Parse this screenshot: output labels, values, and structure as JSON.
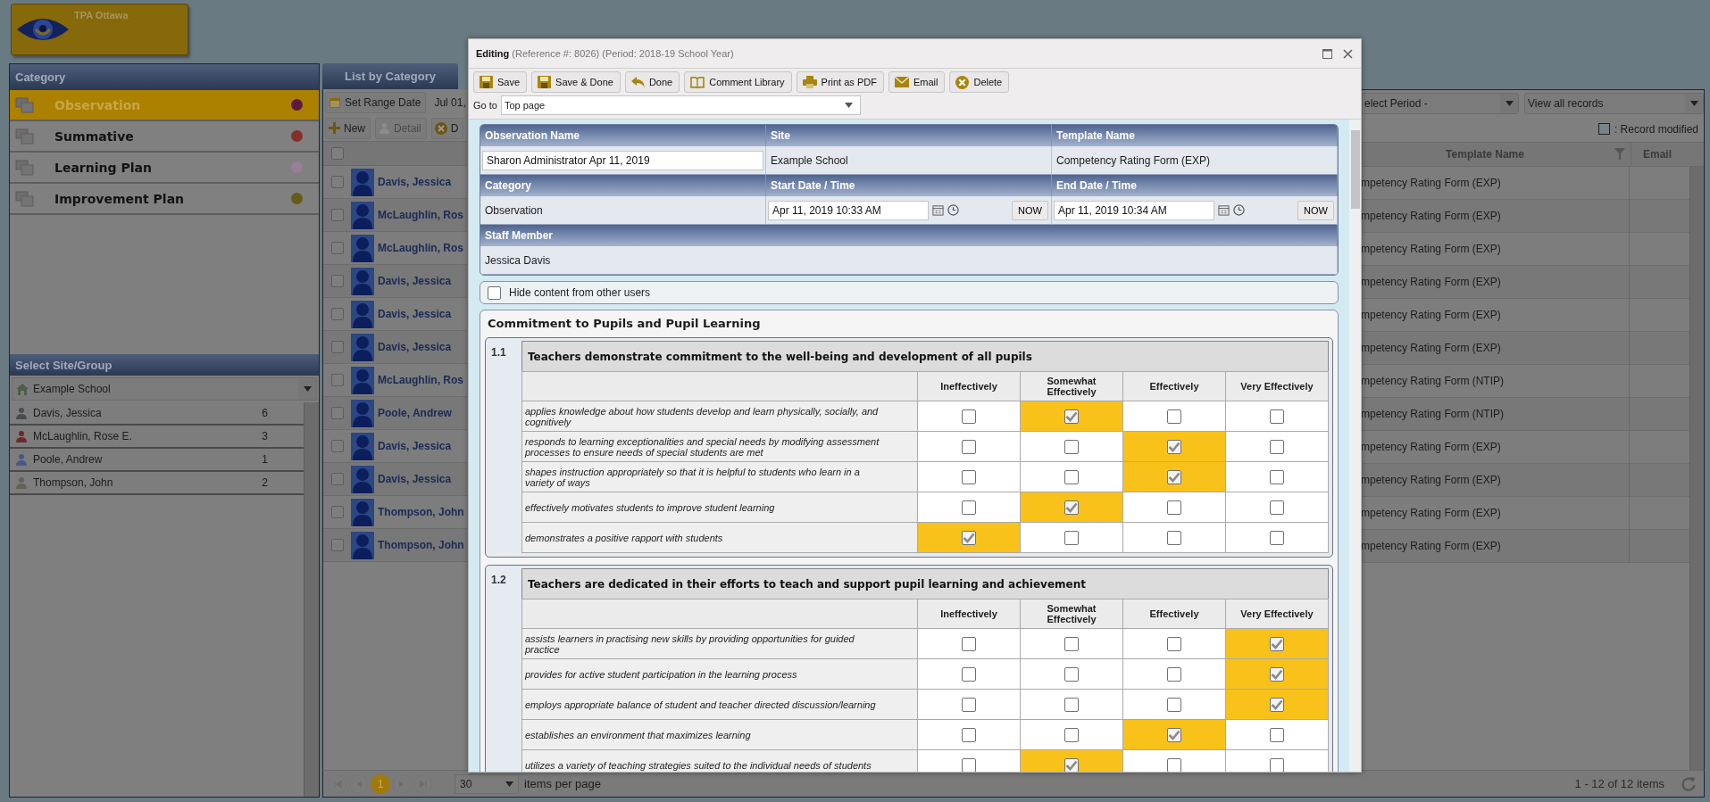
{
  "app_logo": {
    "title": "TPA Ottawa"
  },
  "category_panel": {
    "title": "Category",
    "items": [
      {
        "label": "Observation",
        "selected": true,
        "color": "#5e1a3c"
      },
      {
        "label": "Summative",
        "selected": false,
        "color": "#82302a"
      },
      {
        "label": "Learning Plan",
        "selected": false,
        "color": "#9a7e96"
      },
      {
        "label": "Improvement Plan",
        "selected": false,
        "color": "#675a19"
      }
    ]
  },
  "site_panel": {
    "title": "Select Site/Group",
    "site": "Example School",
    "staff": [
      {
        "name": "Davis, Jessica",
        "count": "6",
        "color": "#474c52"
      },
      {
        "name": "McLaughlin, Rose E.",
        "count": "3",
        "color": "#6a2b2b"
      },
      {
        "name": "Poole, Andrew",
        "count": "1",
        "color": "#45598a"
      },
      {
        "name": "Thompson, John",
        "count": "2",
        "color": "#66605a"
      }
    ]
  },
  "list_panel": {
    "tab": "List by Category",
    "range_button": "Set Range Date",
    "range_text": "Jul 01,",
    "period_select": "elect Period -",
    "view_select": "View all records",
    "buttons": [
      {
        "label": "New",
        "kind": "new",
        "disabled": false
      },
      {
        "label": "Detail",
        "kind": "detail",
        "disabled": true
      },
      {
        "label": "D",
        "kind": "delete",
        "disabled": false
      }
    ],
    "legend": ": Record modified",
    "columns": {
      "template": "Template Name",
      "email": "Email"
    },
    "select_all_checked": false,
    "rows": [
      {
        "name": "Davis, Jessica",
        "template": "mpetency Rating Form (EXP)",
        "checked": false
      },
      {
        "name": "McLaughlin, Ros",
        "template": "mpetency Rating Form (EXP)",
        "checked": false
      },
      {
        "name": "McLaughlin, Ros",
        "template": "mpetency Rating Form (EXP)",
        "checked": false
      },
      {
        "name": "Davis, Jessica",
        "template": "mpetency Rating Form (EXP)",
        "checked": false
      },
      {
        "name": "Davis, Jessica",
        "template": "mpetency Rating Form (EXP)",
        "checked": false
      },
      {
        "name": "Davis, Jessica",
        "template": "mpetency Rating Form (EXP)",
        "checked": false
      },
      {
        "name": "McLaughlin, Ros",
        "template": "mpetency Rating Form (NTIP)",
        "checked": false
      },
      {
        "name": "Poole, Andrew",
        "template": "mpetency Rating Form (NTIP)",
        "checked": false
      },
      {
        "name": "Davis, Jessica",
        "template": "mpetency Rating Form (EXP)",
        "checked": false
      },
      {
        "name": "Davis, Jessica",
        "template": "mpetency Rating Form (EXP)",
        "checked": false
      },
      {
        "name": "Thompson, John",
        "template": "mpetency Rating Form (EXP)",
        "checked": false
      },
      {
        "name": "Thompson, John",
        "template": "mpetency Rating Form (EXP)",
        "checked": false
      }
    ],
    "pager": {
      "page": "1",
      "page_size": "30",
      "page_size_label": "items per page",
      "summary": "1 - 12 of 12 items"
    }
  },
  "dialog": {
    "title": "Editing",
    "subtitle": "(Reference #: 8026) (Period: 2018-19 School Year)",
    "toolbar": [
      {
        "label": "Save",
        "kind": "save"
      },
      {
        "label": "Save & Done",
        "kind": "save"
      },
      {
        "label": "Done",
        "kind": "back"
      },
      {
        "label": "Comment Library",
        "kind": "book"
      },
      {
        "label": "Print as PDF",
        "kind": "print"
      },
      {
        "label": "Email",
        "kind": "email"
      },
      {
        "label": "Delete",
        "kind": "delete"
      }
    ],
    "goto": {
      "label": "Go to",
      "value": "Top page"
    },
    "info_rows": [
      {
        "fields": [
          {
            "label": "Observation Name",
            "value": "Sharon Administrator Apr 11, 2019",
            "kind": "input"
          },
          {
            "label": "Site",
            "value": "Example School",
            "kind": "text"
          },
          {
            "label": "Template Name",
            "value": "Competency Rating Form (EXP)",
            "kind": "text"
          }
        ]
      },
      {
        "fields": [
          {
            "label": "Category",
            "value": "Observation",
            "kind": "text"
          },
          {
            "label": "Start Date / Time",
            "value": "Apr 11, 2019 10:33 AM",
            "kind": "datetime",
            "button": "NOW"
          },
          {
            "label": "End Date / Time",
            "value": "Apr 11, 2019 10:34 AM",
            "kind": "datetime",
            "button": "NOW"
          }
        ]
      }
    ],
    "staff": {
      "label": "Staff Member",
      "value": "Jessica Davis"
    },
    "hide_content": {
      "label": "Hide content from other users",
      "checked": false
    },
    "section": {
      "title": "Commitment to Pupils and Pupil Learning",
      "groups": [
        {
          "number": "1.1",
          "title": "Teachers demonstrate commitment to the well-being and development of all pupils",
          "columns": [
            "Ineffectively",
            "Somewhat Effectively",
            "Effectively",
            "Very Effectively"
          ],
          "rows": [
            {
              "text": "applies knowledge about how students develop and learn physically, socially, and cognitively",
              "checked": [
                false,
                true,
                false,
                false
              ]
            },
            {
              "text": "responds to learning exceptionalities and special needs by modifying assessment processes to ensure needs of special students are met",
              "checked": [
                false,
                false,
                true,
                false
              ]
            },
            {
              "text": "shapes instruction appropriately so that it is helpful to students who learn in a variety of ways",
              "checked": [
                false,
                false,
                true,
                false
              ]
            },
            {
              "text": "effectively motivates students to improve student learning",
              "checked": [
                false,
                true,
                false,
                false
              ]
            },
            {
              "text": "demonstrates a positive rapport with students",
              "checked": [
                true,
                false,
                false,
                false
              ]
            }
          ]
        },
        {
          "number": "1.2",
          "title": "Teachers are dedicated in their efforts to teach and support pupil learning and achievement",
          "columns": [
            "Ineffectively",
            "Somewhat Effectively",
            "Effectively",
            "Very Effectively"
          ],
          "rows": [
            {
              "text": "assists learners in practising new skills by providing opportunities for guided practice",
              "checked": [
                false,
                false,
                false,
                true
              ]
            },
            {
              "text": "provides for active student participation in the learning process",
              "checked": [
                false,
                false,
                false,
                true
              ]
            },
            {
              "text": "employs appropriate balance of student and teacher directed discussion/learning",
              "checked": [
                false,
                false,
                false,
                true
              ]
            },
            {
              "text": "establishes an environment that maximizes learning",
              "checked": [
                false,
                false,
                true,
                false
              ]
            },
            {
              "text": "utilizes a variety of teaching strategies suited to the individual needs of students",
              "checked": [
                false,
                true,
                false,
                false
              ]
            }
          ]
        }
      ]
    }
  }
}
